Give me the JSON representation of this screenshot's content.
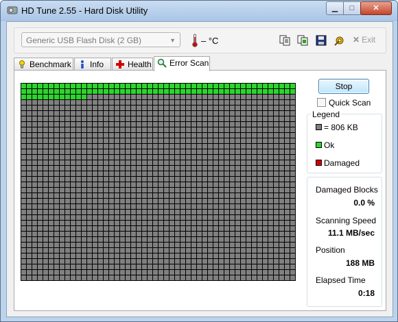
{
  "window": {
    "title": "HD Tune 2.55 - Hard Disk Utility"
  },
  "toolbar": {
    "drive": "Generic USB Flash Disk (2 GB)",
    "temperature": "– °C",
    "exit_label": "Exit",
    "icons": [
      "copy-info-icon",
      "copy-all-icon",
      "save-icon",
      "options-icon"
    ]
  },
  "tabs": [
    {
      "label": "Benchmark",
      "icon": "benchmark-icon",
      "active": false
    },
    {
      "label": "Info",
      "icon": "info-icon",
      "active": false
    },
    {
      "label": "Health",
      "icon": "health-icon",
      "active": false
    },
    {
      "label": "Error Scan",
      "icon": "magnifier-icon",
      "active": true
    }
  ],
  "scan": {
    "columns": 50,
    "rows": 36,
    "ok_blocks": 112,
    "colors": {
      "ok": "#2ed42e",
      "unscanned": "#808080",
      "damaged": "#d40000",
      "grid_line": "#000000"
    }
  },
  "controls": {
    "stop_label": "Stop",
    "quick_scan_label": "Quick Scan",
    "quick_scan_checked": false
  },
  "legend": {
    "title": "Legend",
    "items": [
      {
        "label": "= 806 KB",
        "color": "#808080"
      },
      {
        "label": "Ok",
        "color": "#2ed42e"
      },
      {
        "label": "Damaged",
        "color": "#d40000"
      }
    ]
  },
  "stats": {
    "damaged_blocks_label": "Damaged Blocks",
    "damaged_blocks_value": "0.0 %",
    "speed_label": "Scanning Speed",
    "speed_value": "11.1 MB/sec",
    "position_label": "Position",
    "position_value": "188 MB",
    "elapsed_label": "Elapsed Time",
    "elapsed_value": "0:18"
  }
}
